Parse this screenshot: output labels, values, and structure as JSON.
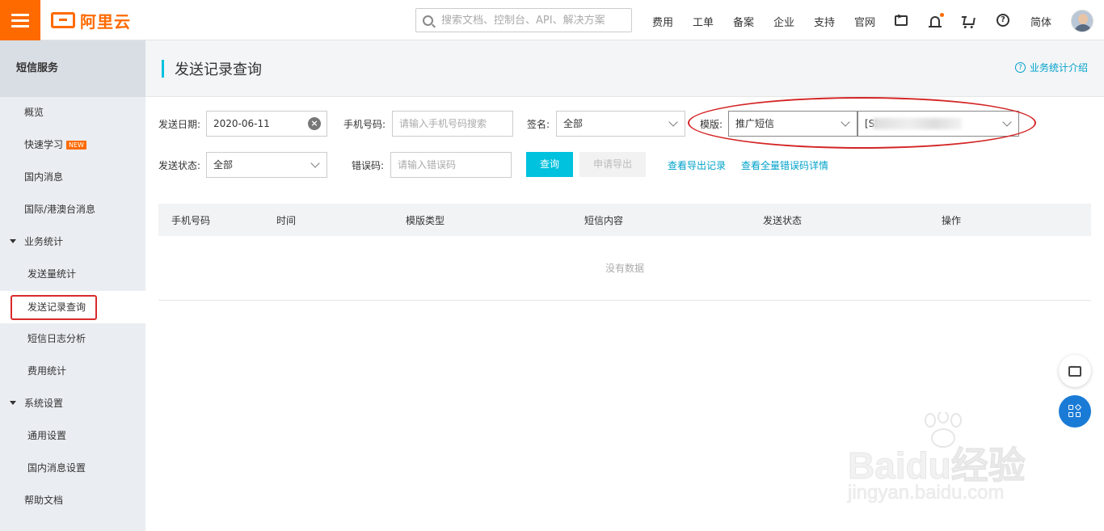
{
  "header": {
    "brand": "阿里云",
    "search_placeholder": "搜索文档、控制台、API、解决方案",
    "nav": [
      "费用",
      "工单",
      "备案",
      "企业",
      "支持",
      "官网"
    ],
    "language": "简体",
    "icons": [
      "terminal-icon",
      "bell-icon",
      "cart-icon",
      "help-icon"
    ]
  },
  "sidebar": {
    "title": "短信服务",
    "items": [
      {
        "label": "概览"
      },
      {
        "label": "快速学习",
        "badge": "NEW"
      },
      {
        "label": "国内消息"
      },
      {
        "label": "国际/港澳台消息"
      },
      {
        "label": "业务统计"
      },
      {
        "label": "发送量统计"
      },
      {
        "label": "发送记录查询"
      },
      {
        "label": "短信日志分析"
      },
      {
        "label": "费用统计"
      },
      {
        "label": "系统设置"
      },
      {
        "label": "通用设置"
      },
      {
        "label": "国内消息设置"
      },
      {
        "label": "帮助文档"
      }
    ]
  },
  "page": {
    "title": "发送记录查询",
    "intro_link": "业务统计介绍"
  },
  "filters": {
    "date_label": "发送日期:",
    "date_value": "2020-06-11",
    "phone_label": "手机号码:",
    "phone_placeholder": "请输入手机号码搜索",
    "sign_label": "签名:",
    "sign_value": "全部",
    "template_label": "模版:",
    "template_type_value": "推广短信",
    "template_name_value": "[SI",
    "status_label": "发送状态:",
    "status_value": "全部",
    "error_label": "错误码:",
    "error_placeholder": "请输入错误码",
    "query_button": "查询",
    "export_button": "申请导出",
    "export_records_link": "查看导出记录",
    "error_details_link": "查看全量错误码详情"
  },
  "table": {
    "columns": [
      "手机号码",
      "时间",
      "模版类型",
      "短信内容",
      "发送状态",
      "操作"
    ],
    "empty_text": "没有数据"
  },
  "watermark": {
    "brand": "Baidu经验",
    "url": "jingyan.baidu.com"
  },
  "colors": {
    "brand_orange": "#ff6a00",
    "accent_cyan": "#00c1de",
    "link": "#00a2ca",
    "annotation_red": "#d42525"
  }
}
